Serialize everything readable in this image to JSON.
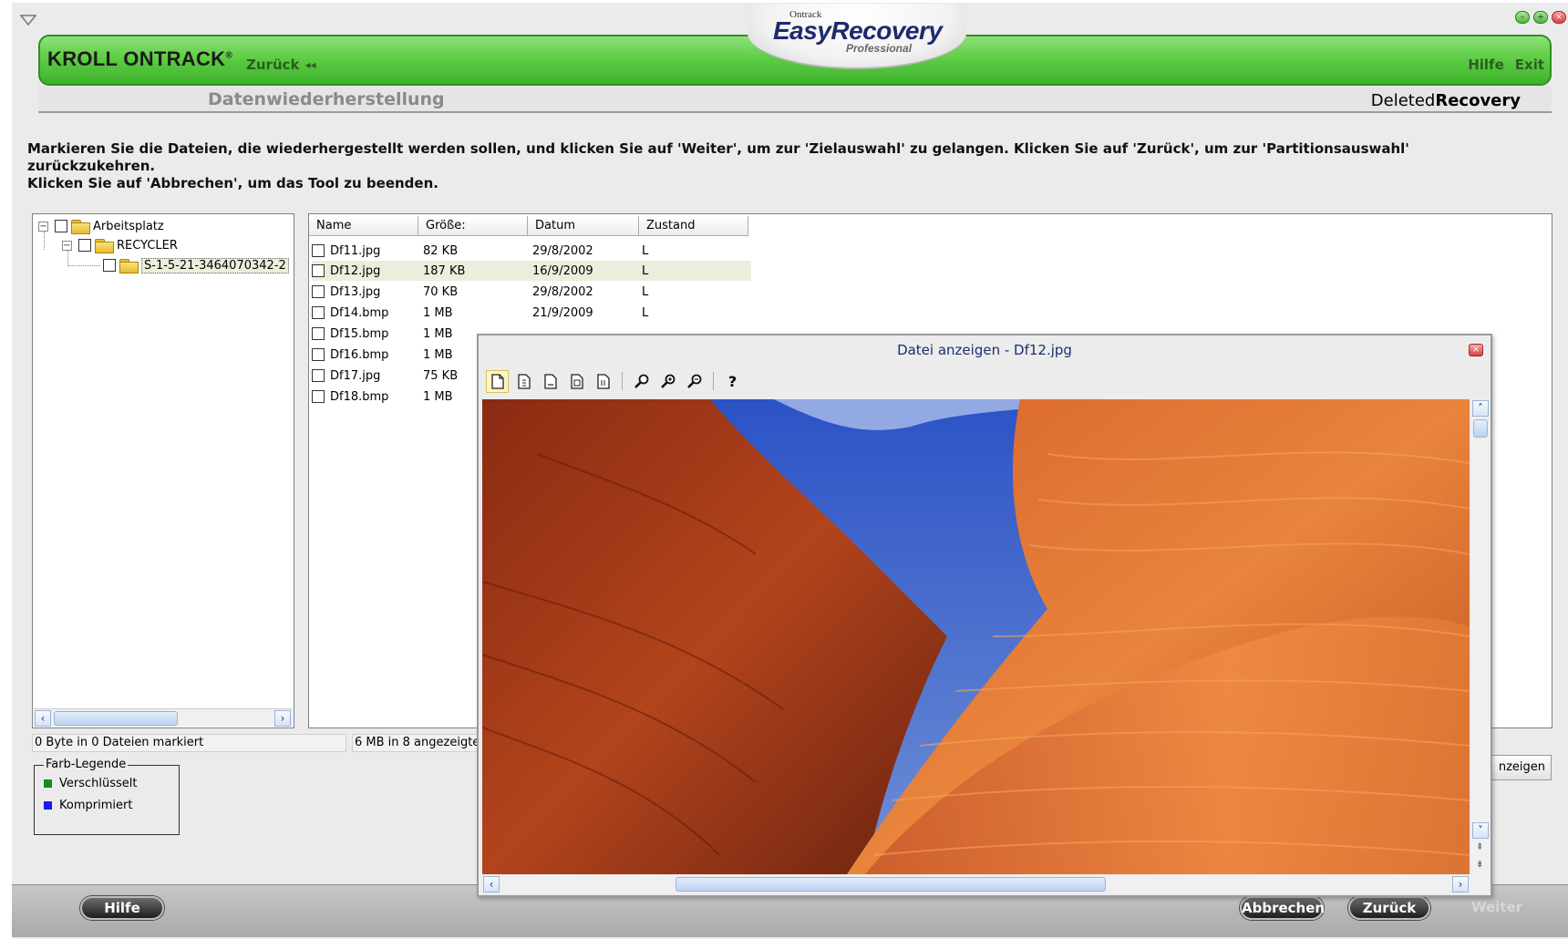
{
  "app": {
    "brand": "KROLL ONTRACK",
    "back_label": "Zurück",
    "help_link": "Hilfe",
    "exit_link": "Exit",
    "logo_small": "Ontrack",
    "logo_main": "EasyRecovery",
    "logo_sub": "Professional",
    "section_title": "Datenwiederherstellung",
    "mode_prefix": "Deleted",
    "mode_suffix": "Recovery"
  },
  "instructions": {
    "line1": "Markieren Sie die Dateien, die wiederhergestellt werden sollen, und klicken Sie auf 'Weiter', um zur 'Zielauswahl' zu gelangen. Klicken Sie auf 'Zurück', um zur 'Partitionsauswahl' zurückzukehren.",
    "line2": "Klicken Sie auf 'Abbrechen', um das Tool zu beenden."
  },
  "tree": {
    "items": [
      {
        "label": "Arbeitsplatz",
        "checked": false,
        "expanded": true
      },
      {
        "label": "RECYCLER",
        "checked": false,
        "expanded": true
      },
      {
        "label": "S-1-5-21-3464070342-2",
        "checked": false,
        "selected": true
      }
    ]
  },
  "file_list": {
    "columns": [
      "Name",
      "Größe:",
      "Datum",
      "Zustand"
    ],
    "rows": [
      {
        "name": "Df11.jpg",
        "size": "82 KB",
        "date": "29/8/2002",
        "state": "L"
      },
      {
        "name": "Df12.jpg",
        "size": "187 KB",
        "date": "16/9/2009",
        "state": "L"
      },
      {
        "name": "Df13.jpg",
        "size": "70 KB",
        "date": "29/8/2002",
        "state": "L"
      },
      {
        "name": "Df14.bmp",
        "size": "1 MB",
        "date": "21/9/2009",
        "state": "L"
      },
      {
        "name": "Df15.bmp",
        "size": "1 MB",
        "date": "",
        "state": ""
      },
      {
        "name": "Df16.bmp",
        "size": "1 MB",
        "date": "",
        "state": ""
      },
      {
        "name": "Df17.jpg",
        "size": "75 KB",
        "date": "",
        "state": ""
      },
      {
        "name": "Df18.bmp",
        "size": "1 MB",
        "date": "",
        "state": ""
      }
    ],
    "selected_row": 1
  },
  "status": {
    "marked": "0 Byte in 0 Dateien markiert",
    "shown": "6 MB in 8 angezeigte"
  },
  "legend": {
    "title": "Farb-Legende",
    "items": [
      {
        "label": "Verschlüsselt",
        "color": "#1a8a1a"
      },
      {
        "label": "Komprimiert",
        "color": "#1a1aee"
      }
    ]
  },
  "anzeigen_label": "nzeigen",
  "bottom": {
    "help": "Hilfe",
    "cancel": "Abbrechen",
    "back": "Zurück",
    "next": "Weiter"
  },
  "viewer": {
    "title": "Datei anzeigen - Df12.jpg",
    "toolbar_icons": [
      "page-icon",
      "page-1-icon",
      "page-2-icon",
      "page-3-icon",
      "page-4-icon",
      "zoom-icon",
      "zoom-in-icon",
      "zoom-out-icon",
      "help-icon"
    ],
    "help_glyph": "?"
  },
  "colors": {
    "header_green": "#5fcd46",
    "title_blue": "#1b2d70"
  }
}
